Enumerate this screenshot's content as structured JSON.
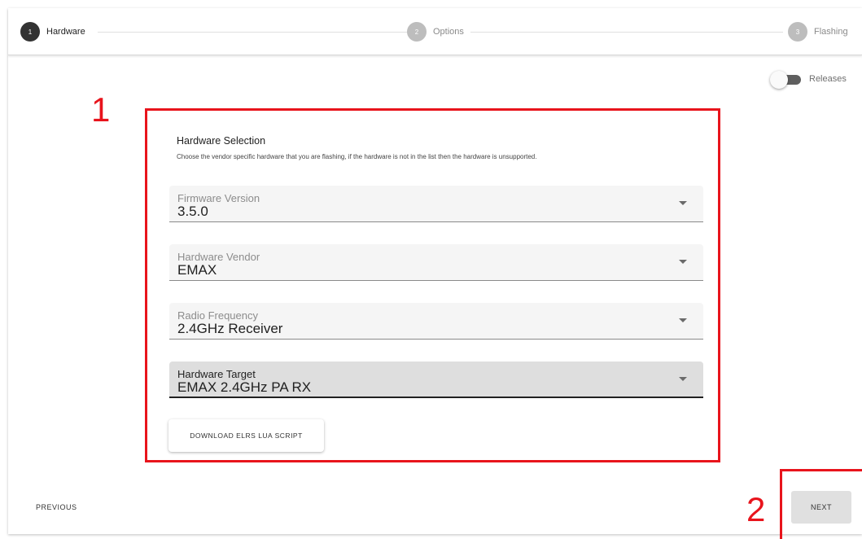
{
  "stepper": {
    "steps": [
      {
        "number": "1",
        "label": "Hardware",
        "state": "active"
      },
      {
        "number": "2",
        "label": "Options",
        "state": "inactive"
      },
      {
        "number": "3",
        "label": "Flashing",
        "state": "inactive"
      }
    ]
  },
  "toggle": {
    "label": "Releases",
    "on": false
  },
  "form": {
    "title": "Hardware Selection",
    "description": "Choose the vendor specific hardware that you are flashing, if the hardware is not in the list then the hardware is unsupported.",
    "fields": [
      {
        "label": "Firmware Version",
        "value": "3.5.0"
      },
      {
        "label": "Hardware Vendor",
        "value": "EMAX"
      },
      {
        "label": "Radio Frequency",
        "value": "2.4GHz Receiver"
      },
      {
        "label": "Hardware Target",
        "value": "EMAX 2.4GHz PA RX"
      }
    ],
    "download_button": "DOWNLOAD ELRS LUA SCRIPT"
  },
  "navigation": {
    "previous": "PREVIOUS",
    "next": "NEXT"
  },
  "annotations": {
    "box_number": "1",
    "next_number": "2"
  },
  "colors": {
    "annotation": "#e8141c",
    "active_step": "#333333",
    "inactive_step": "#bdbdbd"
  }
}
